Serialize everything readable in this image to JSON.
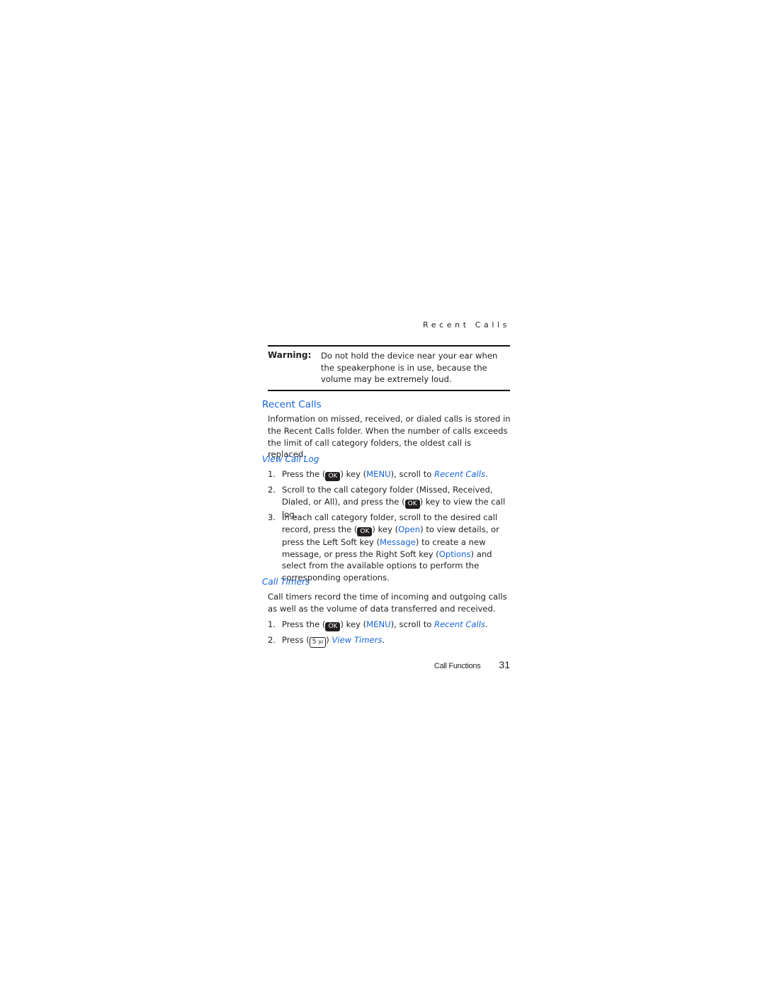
{
  "running_head": "Recent Calls",
  "warning": {
    "label": "Warning:",
    "text": "Do not hold the device near your ear when the speakerphone is in use, because the volume may be extremely loud."
  },
  "section": {
    "title": "Recent Calls",
    "intro": "Information on missed, received, or dialed calls is stored in the Recent Calls folder. When the number of calls exceeds the limit of call category folders, the oldest call is replaced."
  },
  "view_call_log": {
    "title": "View Call Log",
    "steps": [
      {
        "num": "1.",
        "pre": "Press the (",
        "key": "OK",
        "mid": ") key (",
        "soft": "MENU",
        "post": "), scroll to ",
        "target": "Recent Calls",
        "end": "."
      },
      {
        "num": "2.",
        "pre": "Scroll to the call category folder (Missed, Received, Dialed, or All), and press the (",
        "key": "OK",
        "post": ") key to view the call log."
      },
      {
        "num": "3.",
        "pre": "In each call category folder, scroll to the desired call record, press the (",
        "key": "OK",
        "mid": ") key (",
        "soft1": "Open",
        "mid2": ") to view details, or press the Left Soft key (",
        "soft2": "Message",
        "mid3": ") to create a new message, or press the Right Soft key (",
        "soft3": "Options",
        "post": ") and select from the available options to perform the corresponding operations."
      }
    ]
  },
  "call_timers": {
    "title": "Call Timers",
    "intro": "Call timers record the time of incoming and outgoing calls as well as the volume of data transferred and received.",
    "steps": [
      {
        "num": "1.",
        "pre": "Press the (",
        "key": "OK",
        "mid": ") key (",
        "soft": "MENU",
        "post": "), scroll to ",
        "target": "Recent Calls",
        "end": "."
      },
      {
        "num": "2.",
        "pre": "Press (",
        "key": "5",
        "key_sub": "jkl",
        "post": ") ",
        "target": "View Timers",
        "end": "."
      }
    ]
  },
  "footer": {
    "section": "Call Functions",
    "page_number": "31"
  },
  "colors": {
    "accent_blue": "#1565d8",
    "text": "#231f20"
  }
}
